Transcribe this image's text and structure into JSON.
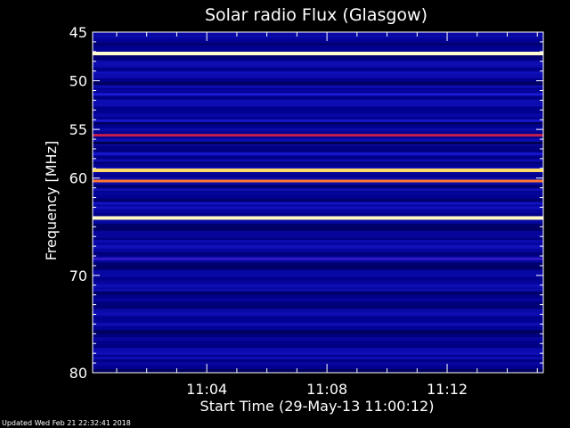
{
  "chart_data": {
    "type": "heatmap",
    "title": "Solar radio Flux (Glasgow)",
    "xlabel": "Start Time (29-May-13 11:00:12)",
    "ylabel": "Frequency [MHz]",
    "x_start_minutes": 0.2,
    "x_end_minutes": 15.2,
    "xlim": [
      "11:00:12",
      "11:15:12"
    ],
    "ylim": [
      45,
      80
    ],
    "y_ticks": [
      45,
      50,
      55,
      60,
      70,
      80
    ],
    "y_tick_labels": [
      "45",
      "50",
      "55",
      "60",
      "70",
      "80"
    ],
    "x_ticks": [
      "11:04",
      "11:08",
      "11:12"
    ],
    "x_ticks_minutes": [
      4,
      8,
      12
    ],
    "colormap": [
      "#000010",
      "#00008c",
      "#1a1ad8",
      "#ff2020",
      "#ffd040",
      "#ffffd0"
    ],
    "bands": [
      {
        "freq": 45.6,
        "intensity": 0.25
      },
      {
        "freq": 46.5,
        "intensity": 0.2
      },
      {
        "freq": 47.2,
        "intensity": 1.0
      },
      {
        "freq": 48.3,
        "intensity": 0.3
      },
      {
        "freq": 49.2,
        "intensity": 0.32
      },
      {
        "freq": 50.6,
        "intensity": 0.3
      },
      {
        "freq": 51.4,
        "intensity": 0.4
      },
      {
        "freq": 52.5,
        "intensity": 0.3
      },
      {
        "freq": 54.1,
        "intensity": 0.38
      },
      {
        "freq": 55.6,
        "intensity": 0.55
      },
      {
        "freq": 56.4,
        "intensity": 0.1
      },
      {
        "freq": 57.5,
        "intensity": 0.38
      },
      {
        "freq": 58.2,
        "intensity": 0.3
      },
      {
        "freq": 59.2,
        "intensity": 0.85
      },
      {
        "freq": 60.3,
        "intensity": 0.7
      },
      {
        "freq": 61.2,
        "intensity": 0.32
      },
      {
        "freq": 62.6,
        "intensity": 0.35
      },
      {
        "freq": 64.1,
        "intensity": 0.98
      },
      {
        "freq": 66.5,
        "intensity": 0.3
      },
      {
        "freq": 68.3,
        "intensity": 0.42
      },
      {
        "freq": 71.5,
        "intensity": 0.3
      },
      {
        "freq": 75.0,
        "intensity": 0.3
      },
      {
        "freq": 78.5,
        "intensity": 0.3
      }
    ]
  },
  "footer": "Updated Wed Feb 21 22:32:41 2018"
}
